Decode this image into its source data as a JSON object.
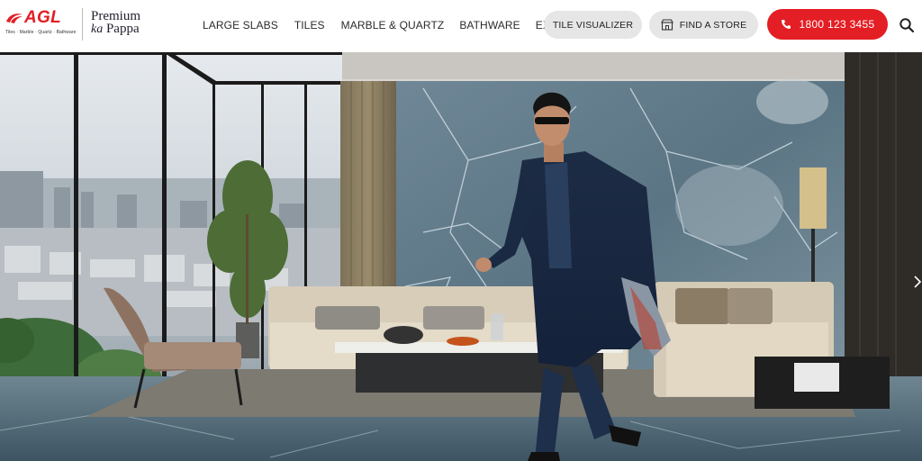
{
  "brand": {
    "logo_text": "AGL",
    "logo_tagline": "Tiles · Marble · Quartz · Bathware",
    "tagline_line1": "Premium",
    "tagline_ka": "ka",
    "tagline_line2": "Pappa",
    "accent_color": "#e31e24"
  },
  "nav": {
    "items": [
      {
        "label": "LARGE SLABS"
      },
      {
        "label": "TILES"
      },
      {
        "label": "MARBLE & QUARTZ"
      },
      {
        "label": "BATHWARE"
      },
      {
        "label": "EXPORTS"
      }
    ]
  },
  "actions": {
    "tile_visualizer": "TILE VISUALIZER",
    "find_store": "FIND A STORE",
    "phone": "1800 123 3455",
    "store_icon": "storefront-icon",
    "phone_icon": "phone-icon",
    "search_icon": "search-icon"
  },
  "hero": {
    "image": "living-room-hero",
    "next_icon": "chevron-right-icon"
  }
}
